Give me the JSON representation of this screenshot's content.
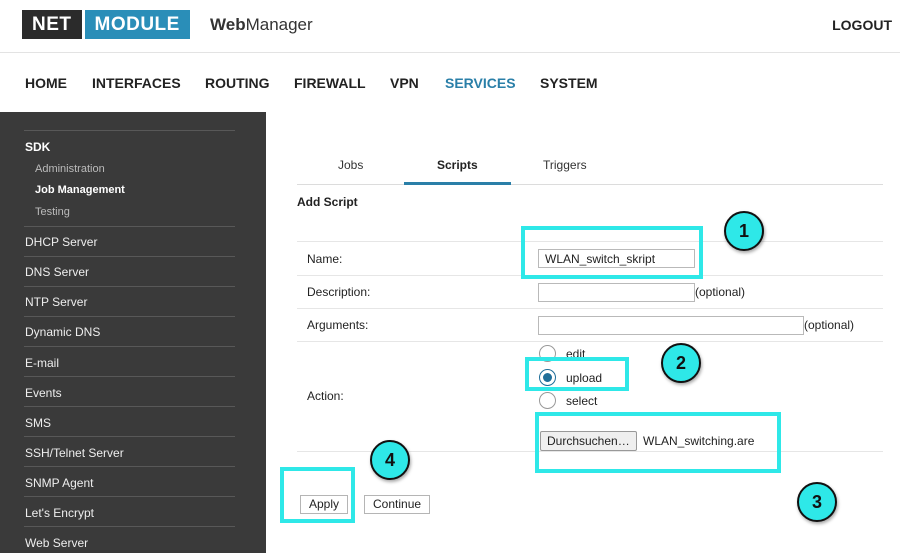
{
  "header": {
    "logo_part1": "NET",
    "logo_part2": "MODULE",
    "brand_bold": "Web",
    "brand_rest": "Manager",
    "logout": "LOGOUT"
  },
  "topnav": [
    "HOME",
    "INTERFACES",
    "ROUTING",
    "FIREWALL",
    "VPN",
    "SERVICES",
    "SYSTEM"
  ],
  "topnav_active": "SERVICES",
  "sidebar": {
    "section": "SDK",
    "sub_items": [
      "Administration",
      "Job Management",
      "Testing"
    ],
    "active_sub": "Job Management",
    "items": [
      "DHCP Server",
      "DNS Server",
      "NTP Server",
      "Dynamic DNS",
      "E-mail",
      "Events",
      "SMS",
      "SSH/Telnet Server",
      "SNMP Agent",
      "Let's Encrypt",
      "Web Server"
    ]
  },
  "tabs": [
    "Jobs",
    "Scripts",
    "Triggers"
  ],
  "active_tab": "Scripts",
  "form": {
    "title": "Add Script",
    "name_label": "Name:",
    "name_value": "WLAN_switch_skript",
    "description_label": "Description:",
    "description_value": "",
    "description_hint": "(optional)",
    "arguments_label": "Arguments:",
    "arguments_value": "",
    "arguments_hint": "(optional)",
    "action_label": "Action:",
    "action_options": [
      "edit",
      "upload",
      "select"
    ],
    "action_selected": "upload",
    "file_button": "Durchsuchen…",
    "file_name": "WLAN_switching.are",
    "apply": "Apply",
    "continue": "Continue"
  },
  "annotations": {
    "highlight_color": "#2ee8e8",
    "badges": [
      "1",
      "2",
      "3",
      "4"
    ]
  },
  "colors": {
    "accent": "#2a7fa8",
    "logo_dark": "#2b2b2b",
    "logo_blue": "#2a8eb8",
    "sidebar_bg": "#3a3a3a"
  }
}
